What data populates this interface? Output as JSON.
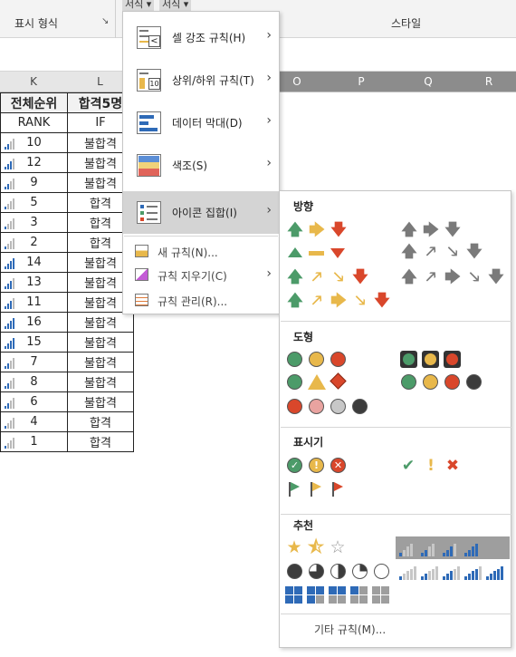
{
  "ribbon": {
    "group_display_format": "표시 형식",
    "group_style": "스타일",
    "tab_a": "서식 ▾",
    "tab_b": "서식 ▾"
  },
  "sheet": {
    "columns_left": [
      "K",
      "L"
    ],
    "columns_right": [
      "O",
      "P",
      "Q",
      "R"
    ],
    "header_row": [
      "전체순위",
      "합격5명"
    ],
    "sub_header_row": [
      "RANK",
      "IF"
    ],
    "rows": [
      {
        "rank": "10",
        "result": "불합격"
      },
      {
        "rank": "12",
        "result": "불합격"
      },
      {
        "rank": "9",
        "result": "불합격"
      },
      {
        "rank": "5",
        "result": "합격"
      },
      {
        "rank": "3",
        "result": "합격"
      },
      {
        "rank": "2",
        "result": "합격"
      },
      {
        "rank": "14",
        "result": "불합격"
      },
      {
        "rank": "13",
        "result": "불합격"
      },
      {
        "rank": "11",
        "result": "불합격"
      },
      {
        "rank": "16",
        "result": "불합격"
      },
      {
        "rank": "15",
        "result": "불합격"
      },
      {
        "rank": "7",
        "result": "불합격"
      },
      {
        "rank": "8",
        "result": "불합격"
      },
      {
        "rank": "6",
        "result": "불합격"
      },
      {
        "rank": "4",
        "result": "합격"
      },
      {
        "rank": "1",
        "result": "합격"
      }
    ],
    "bar_level_by_rank_note": "bar fill levels shown in rank cells",
    "bar_levels": [
      2,
      3,
      2,
      1,
      1,
      1,
      4,
      3,
      3,
      4,
      4,
      2,
      2,
      2,
      1,
      1
    ]
  },
  "menu": {
    "items": [
      {
        "label": "셀 강조 규칙(H)",
        "has_submenu": true
      },
      {
        "label": "상위/하위 규칙(T)",
        "has_submenu": true
      },
      {
        "label": "데이터 막대(D)",
        "has_submenu": true
      },
      {
        "label": "색조(S)",
        "has_submenu": true
      },
      {
        "label": "아이콘 집합(I)",
        "has_submenu": true,
        "highlighted": true
      }
    ],
    "small_items": [
      {
        "label": "새 규칙(N)...",
        "has_submenu": false
      },
      {
        "label": "규칙 지우기(C)",
        "has_submenu": true
      },
      {
        "label": "규칙 관리(R)...",
        "has_submenu": false
      }
    ],
    "top_rules_icon_text": "10"
  },
  "submenu": {
    "section_direction": "방향",
    "section_shapes": "도형",
    "section_indicators": "표시기",
    "section_ratings": "추천",
    "more_rules": "기타 규칙(M)...",
    "colors": {
      "green": "#4c9b69",
      "yellow": "#e8b84b",
      "red": "#d9472b",
      "gray": "#7a7a7a",
      "dark": "#3c3c3c",
      "pink": "#e9a3a0",
      "blue": "#2e6ab7",
      "light_gray": "#c7c7c7"
    }
  }
}
